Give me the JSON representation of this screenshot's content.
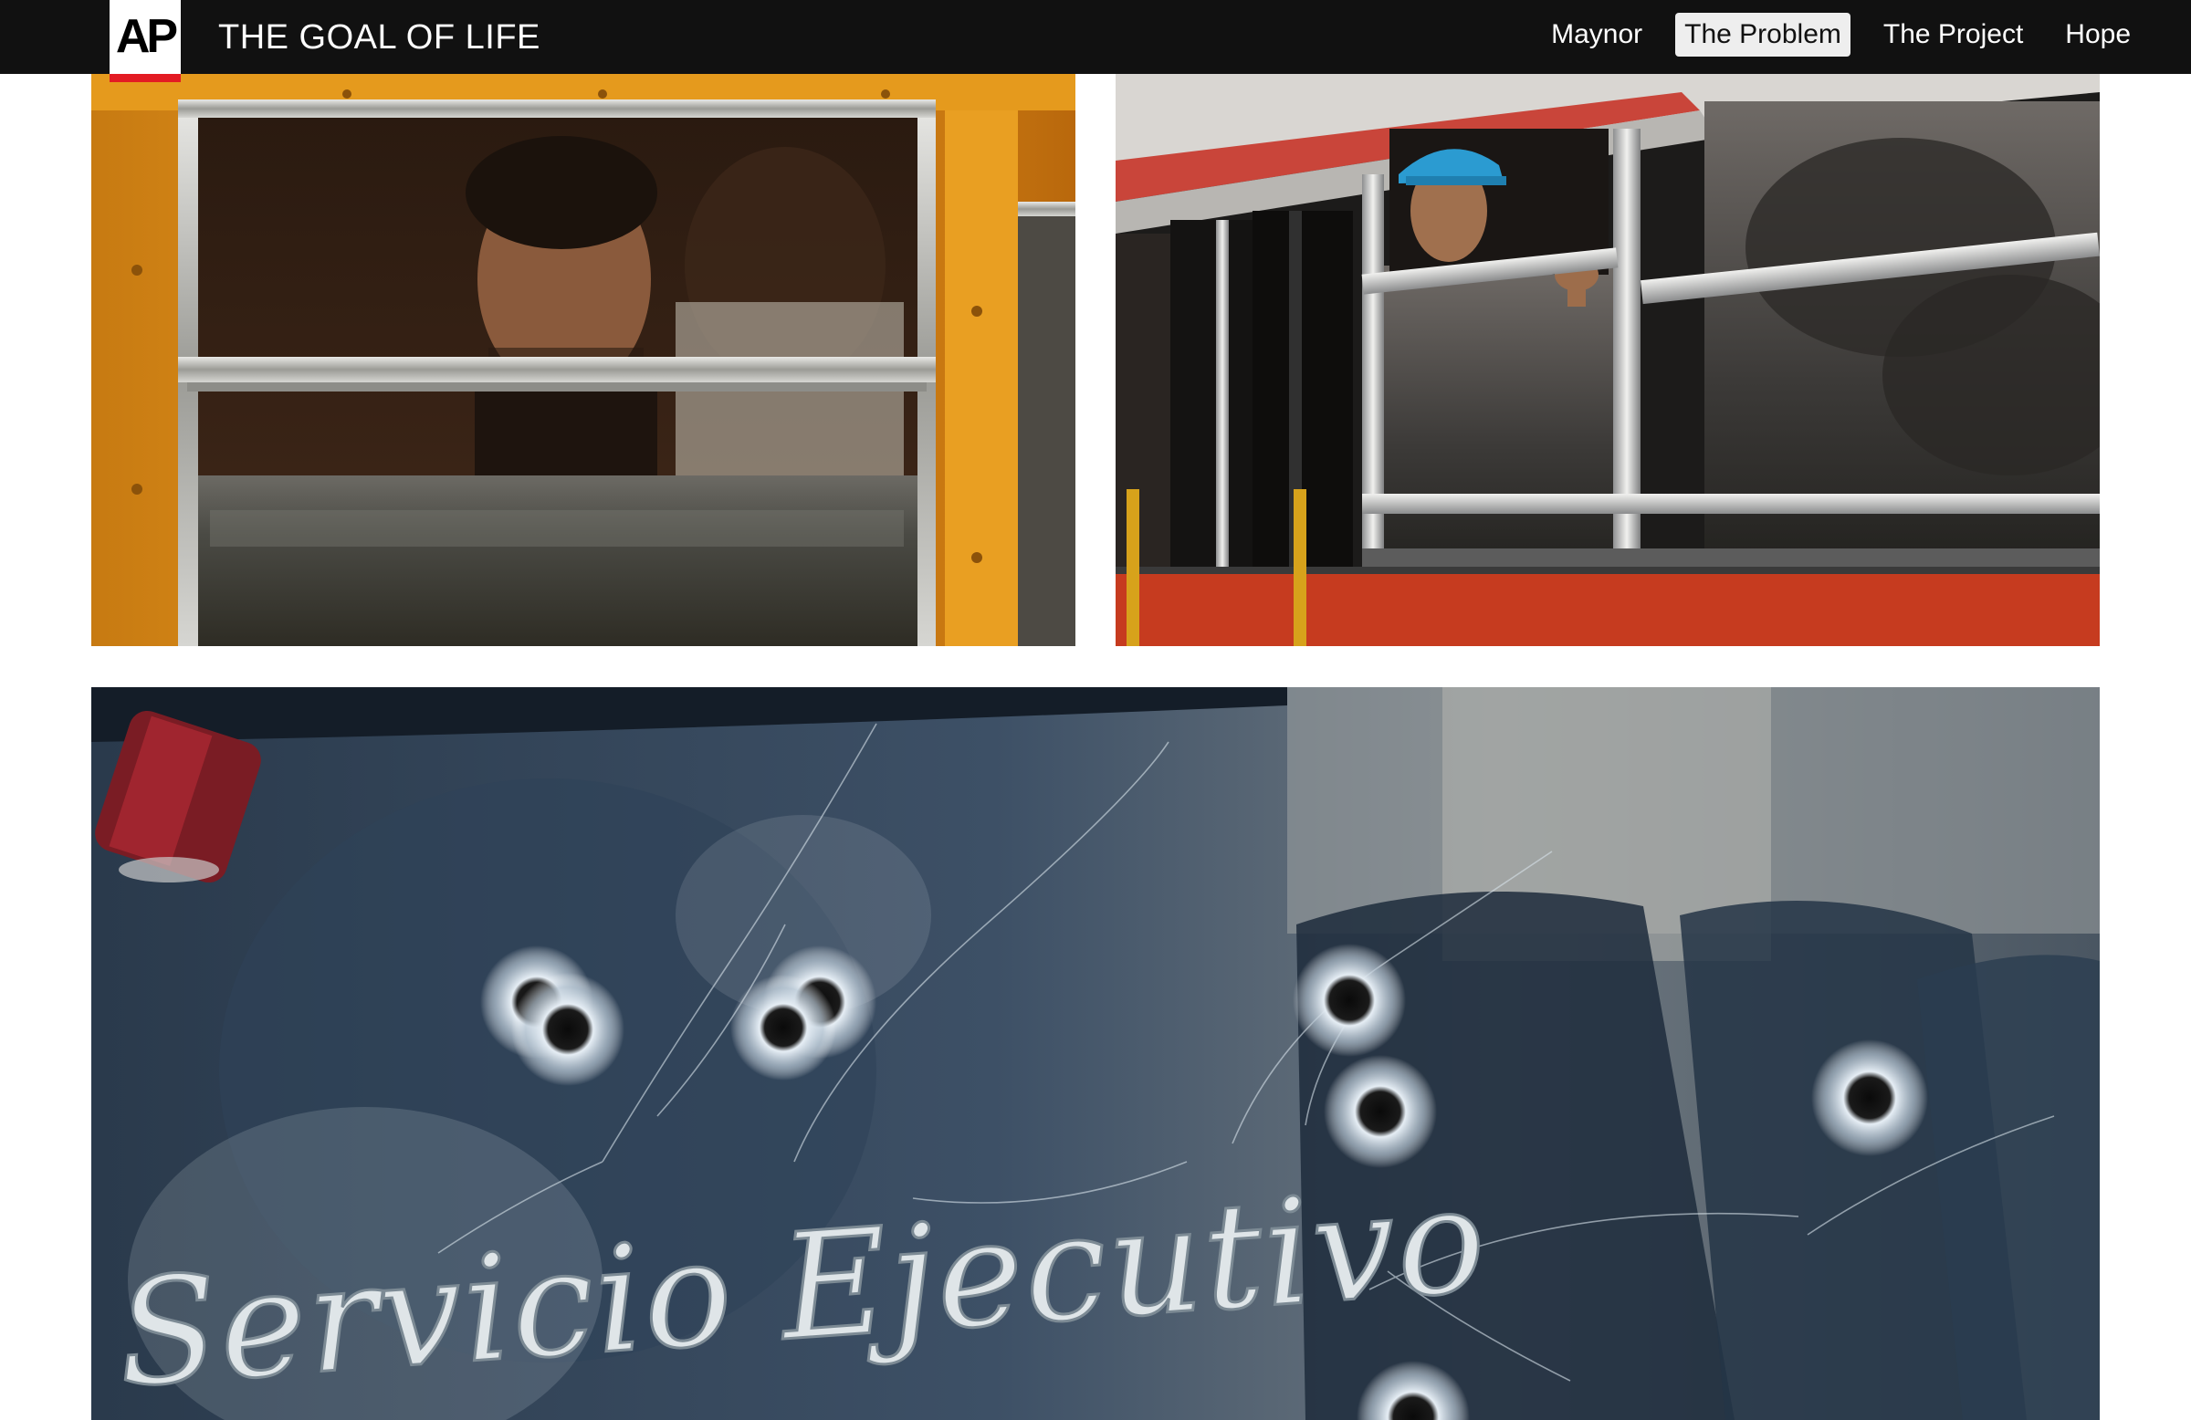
{
  "header": {
    "logo_text": "AP",
    "title": "THE GOAL OF LIFE",
    "nav": [
      {
        "label": "Maynor",
        "active": false
      },
      {
        "label": "The Problem",
        "active": true
      },
      {
        "label": "The Project",
        "active": false
      },
      {
        "label": "Hope",
        "active": false
      }
    ]
  },
  "photos": [
    {
      "id": "yellow-bus",
      "subject": "man looking out of a yellow school bus window"
    },
    {
      "id": "red-bus",
      "subject": "young man in blue cap leaning out of a red bus window"
    },
    {
      "id": "windshield",
      "subject": "bus windshield with bullet holes",
      "painted_text": "Servicio Ejecutivo"
    }
  ],
  "colors": {
    "topbar": "#111111",
    "logo_red": "#e31b23",
    "active_nav_bg": "#eeeeee"
  }
}
